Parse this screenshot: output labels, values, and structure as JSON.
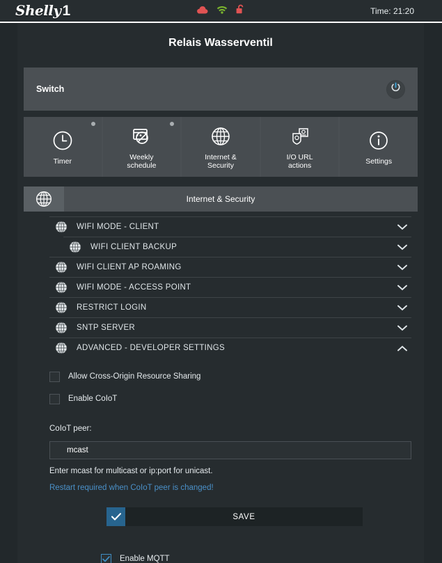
{
  "header": {
    "logo_text": "Shelly",
    "logo_model": "1",
    "icons": [
      {
        "name": "cloud-icon",
        "color": "#e05353"
      },
      {
        "name": "wifi-icon",
        "color": "#7ab32e"
      },
      {
        "name": "unlocked-padlock-icon",
        "color": "#e05353"
      }
    ],
    "time_label": "Time: 21:20"
  },
  "page": {
    "title": "Relais Wasserventil"
  },
  "switch_panel": {
    "label": "Switch",
    "power_icon": "power-icon",
    "power_color": "#3ba3d8"
  },
  "tabs": [
    {
      "label": "Timer",
      "icon": "clock-icon",
      "dot": true
    },
    {
      "label": "Weekly\nschedule",
      "icon": "calendar-icon",
      "dot": true
    },
    {
      "label": "Internet &\nSecurity",
      "icon": "globe-icon",
      "dot": false
    },
    {
      "label": "I/O URL\nactions",
      "icon": "url-actions-icon",
      "dot": false
    },
    {
      "label": "Settings",
      "icon": "info-icon",
      "dot": false
    }
  ],
  "section": {
    "icon": "globe-icon",
    "title": "Internet & Security"
  },
  "accordion": [
    {
      "label": "WIFI MODE - CLIENT",
      "icon": "globe-icon",
      "expanded": false,
      "indented": false
    },
    {
      "label": "WIFI CLIENT BACKUP",
      "icon": "globe-icon",
      "expanded": false,
      "indented": true
    },
    {
      "label": "WIFI CLIENT AP ROAMING",
      "icon": "globe-icon",
      "expanded": false,
      "indented": false
    },
    {
      "label": "WIFI MODE - ACCESS POINT",
      "icon": "globe-icon",
      "expanded": false,
      "indented": false
    },
    {
      "label": "RESTRICT LOGIN",
      "icon": "globe-icon",
      "expanded": false,
      "indented": false
    },
    {
      "label": "SNTP SERVER",
      "icon": "globe-icon",
      "expanded": false,
      "indented": false
    },
    {
      "label": "ADVANCED - DEVELOPER SETTINGS",
      "icon": "globe-icon",
      "expanded": true,
      "indented": false
    }
  ],
  "advanced": {
    "cors_label": "Allow Cross-Origin Resource Sharing",
    "cors_checked": false,
    "coiot_label": "Enable CoIoT",
    "coiot_checked": false,
    "peer_field_label": "CoIoT peer:",
    "peer_value": "mcast",
    "peer_placeholder": "mcast",
    "helper_text": "Enter mcast for multicast or ip:port for unicast.",
    "warning_text": "Restart required when CoIoT peer is changed!",
    "warning_color": "#4a90c8",
    "save_label": "SAVE",
    "save_check_icon": "check-icon"
  },
  "mqtt": {
    "label": "Enable MQTT",
    "checked": true
  }
}
